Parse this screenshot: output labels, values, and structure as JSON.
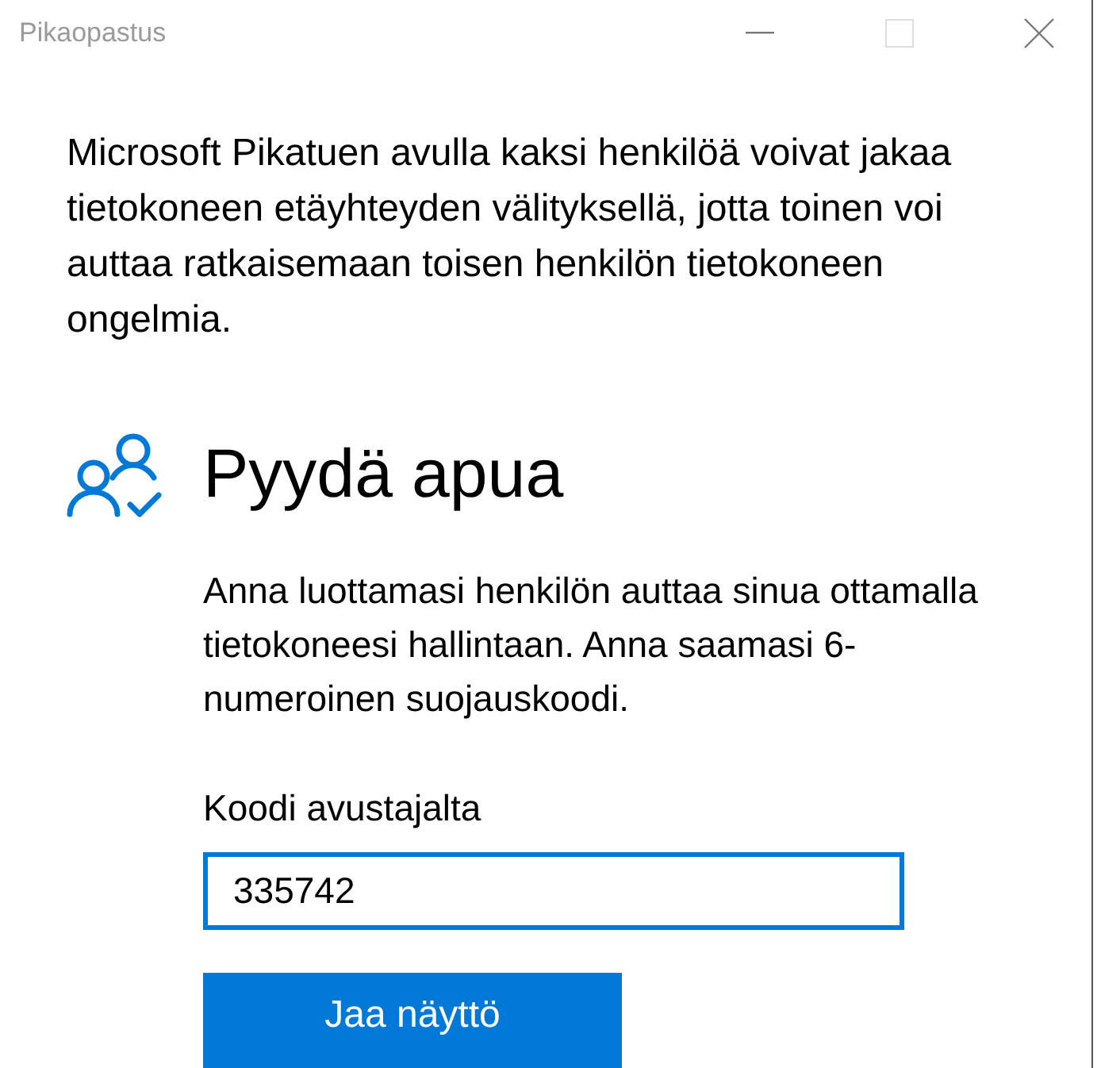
{
  "window": {
    "title": "Pikaopastus"
  },
  "intro": "Microsoft Pikatuen avulla kaksi henkilöä voivat jakaa tietokoneen etäyhteyden välityksellä, jotta toinen voi auttaa ratkaisemaan toisen henkilön tietokoneen ongelmia.",
  "section": {
    "heading": "Pyydä apua",
    "description": "Anna luottamasi henkilön auttaa sinua ottamalla tietokoneesi hallintaan. Anna saamasi 6-numeroinen suojauskoodi.",
    "field": {
      "label": "Koodi avustajalta",
      "value": "335742",
      "focused": true
    },
    "button": "Jaa näyttö"
  }
}
